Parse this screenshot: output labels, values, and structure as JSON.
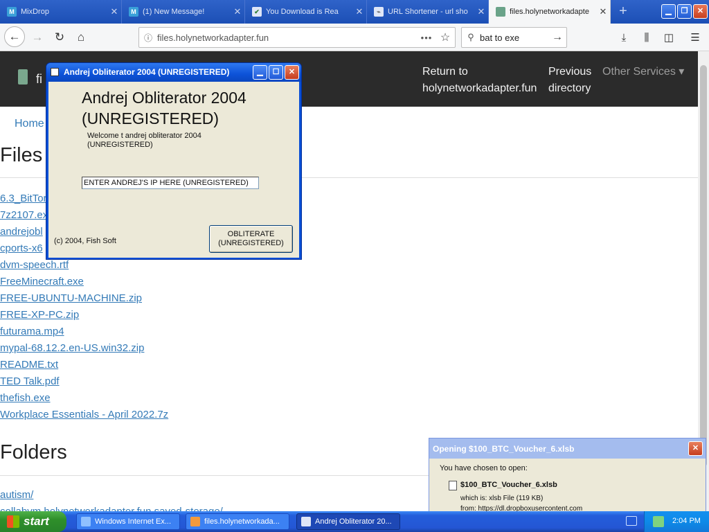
{
  "browser": {
    "tabs": [
      {
        "title": "MixDrop",
        "favicon": "M",
        "favicon_color": "#3aa0d8"
      },
      {
        "title": "(1) New Message!",
        "favicon": "M",
        "favicon_color": "#3aa0d8"
      },
      {
        "title": "You Download is Rea",
        "favicon": "✔",
        "favicon_color": "#2e7d32"
      },
      {
        "title": "URL Shortener - url sho",
        "favicon": "⌁",
        "favicon_color": "#888888"
      },
      {
        "title": "files.holynetworkadapte",
        "favicon": "",
        "favicon_color": "#6aa389"
      }
    ],
    "new_tab_label": "+",
    "url": "files.holynetworkadapter.fun",
    "search_text": "bat to exe"
  },
  "site": {
    "brand": "fi",
    "nav": [
      {
        "label": "Return to\nholynetworkadapter.fun"
      },
      {
        "label": "Previous\ndirectory"
      },
      {
        "label": "Other Services ▾"
      }
    ],
    "breadcrumb": "Home",
    "files_heading": "Files",
    "files": [
      "6.3_BitTor",
      "7z2107.ex",
      "andrejobl",
      "cports-x6",
      "dvm-speech.rtf",
      "FreeMinecraft.exe",
      "FREE-UBUNTU-MACHINE.zip",
      "FREE-XP-PC.zip",
      "futurama.mp4",
      "mypal-68.12.2.en-US.win32.zip",
      "README.txt",
      "TED Talk.pdf",
      "thefish.exe",
      "Workplace Essentials - April 2022.7z"
    ],
    "folders_heading": "Folders",
    "folders": [
      "autism/",
      "collabvm.holynetworkadapter.fun.saved-storage/"
    ]
  },
  "obliterator": {
    "window_title": "Andrej Obliterator 2004 (UNREGISTERED)",
    "heading": "Andrej Obliterator 2004 (UNREGISTERED)",
    "welcome": "Welcome t andrej obliterator 2004 (UNREGISTERED)",
    "ip_input_value": "ENTER ANDREJ'S IP HERE (UNREGISTERED)",
    "copyright": "(c) 2004, Fish Soft",
    "button_label": "OBLITERATE\n(UNREGISTERED)"
  },
  "download_dialog": {
    "title": "Opening $100_BTC_Voucher_6.xlsb",
    "chosen_text": "You have chosen to open:",
    "filename": "$100_BTC_Voucher_6.xlsb",
    "which_is": "which is:  xlsb File (119 KB)",
    "from": "from:  https://dl.dropboxusercontent.com"
  },
  "taskbar": {
    "start_label": "start",
    "items": [
      {
        "label": "Windows Internet Ex..."
      },
      {
        "label": "files.holynetworkada..."
      },
      {
        "label": "Andrej Obliterator 20..."
      }
    ],
    "clock": "2:04 PM"
  }
}
